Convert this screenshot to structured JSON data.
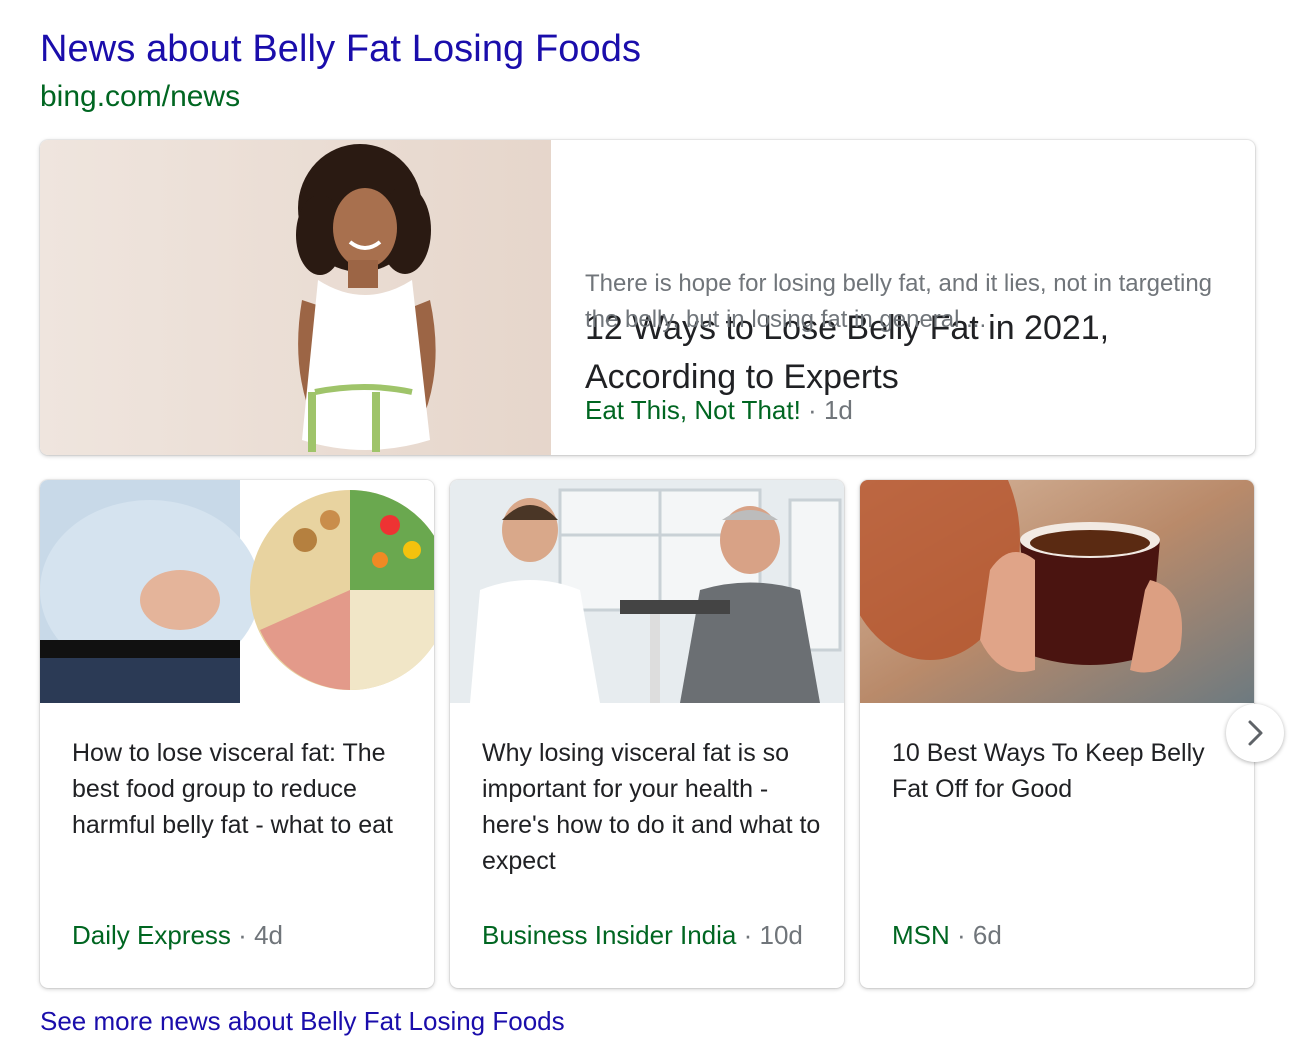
{
  "header": {
    "title": "News about Belly Fat Losing Foods",
    "url": "bing.com/news"
  },
  "featured": {
    "title": "12 Ways to Lose Belly Fat in 2021, According to Experts",
    "snippet": "There is hope for losing belly fat, and it lies, not in targeting the belly, but in losing fat in general ...",
    "source": "Eat This, Not That!",
    "separator": "·",
    "age": "1d"
  },
  "cards": [
    {
      "title": "How to lose visceral fat: The best food group to reduce harmful belly fat - what to eat",
      "source": "Daily Express",
      "separator": "·",
      "age": "4d"
    },
    {
      "title": "Why losing visceral fat is so important for your health - here's how to do it and what to expect",
      "source": "Business Insider India",
      "separator": "·",
      "age": "10d"
    },
    {
      "title": "10 Best Ways To Keep Belly Fat Off for Good",
      "source": "MSN",
      "separator": "·",
      "age": "6d"
    }
  ],
  "carousel": {
    "next_icon": "chevron-right-icon"
  },
  "footer": {
    "link": "See more news about Belly Fat Losing Foods"
  },
  "colors": {
    "link": "#1a0dab",
    "url_green": "#006621",
    "text": "#202124",
    "muted": "#70757a"
  }
}
